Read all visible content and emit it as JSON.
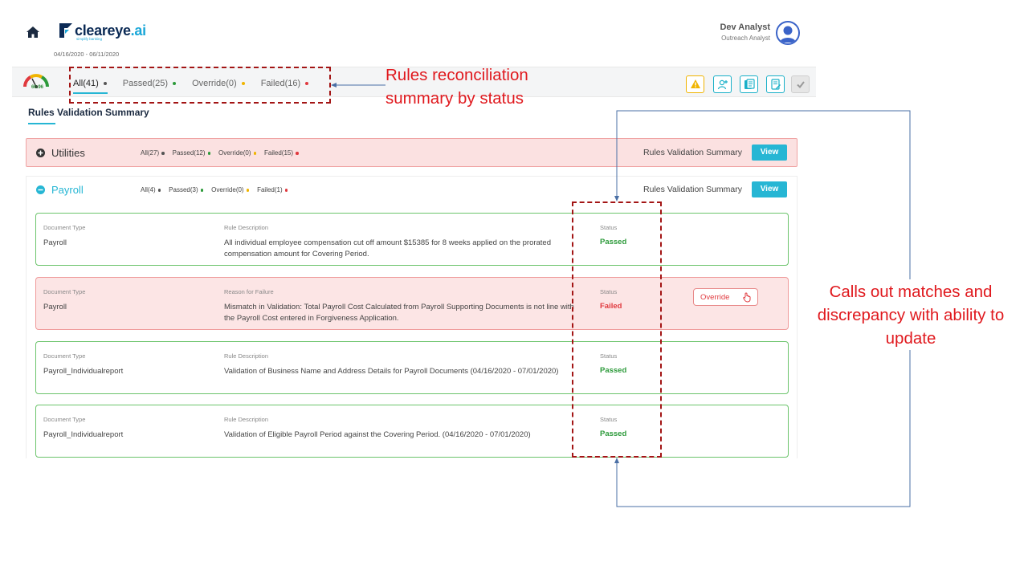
{
  "header": {
    "logo_text": "cleareye",
    "logo_suffix": ".ai",
    "logo_tagline": "simplify banking",
    "date_range": "04/16/2020 - 06/11/2020",
    "user_name": "Dev Analyst",
    "user_role": "Outreach Analyst"
  },
  "gauge": {
    "score": "60.96",
    "score_value": 60.96
  },
  "status_tabs": [
    {
      "label": "All(41)",
      "dot_color": "#555555"
    },
    {
      "label": "Passed(25)",
      "dot_color": "#2c9a3a"
    },
    {
      "label": "Override(0)",
      "dot_color": "#f0b400"
    },
    {
      "label": "Failed(16)",
      "dot_color": "#e0393e"
    }
  ],
  "toolbar_icons": [
    "warning-icon",
    "add-user-icon",
    "document-icon",
    "report-edit-icon",
    "check-icon"
  ],
  "section_title": "Rules Validation Summary",
  "groups": [
    {
      "name": "Utilities",
      "counts": [
        "All(27)",
        "Passed(12)",
        "Override(0)",
        "Failed(15)"
      ],
      "summary_label": "Rules Validation Summary",
      "view_label": "View"
    },
    {
      "name": "Payroll",
      "counts": [
        "All(4)",
        "Passed(3)",
        "Override(0)",
        "Failed(1)"
      ],
      "summary_label": "Rules Validation Summary",
      "view_label": "View"
    }
  ],
  "rules": [
    {
      "doc_type_label": "Document Type",
      "doc_type": "Payroll",
      "desc_label": "Rule Description",
      "description": "All individual employee compensation cut off amount $15385 for 8 weeks applied on the prorated compensation amount for Covering Period.",
      "status_label": "Status",
      "status": "Passed"
    },
    {
      "doc_type_label": "Document Type",
      "doc_type": "Payroll",
      "desc_label": "Reason for Failure",
      "description": "Mismatch in Validation: Total Payroll Cost Calculated from Payroll Supporting Documents is not line with the Payroll Cost entered in Forgiveness Application.",
      "status_label": "Status",
      "status": "Failed",
      "action_label": "Override"
    },
    {
      "doc_type_label": "Document Type",
      "doc_type": "Payroll_Individualreport",
      "desc_label": "Rule Description",
      "description": "Validation of Business Name and Address Details for Payroll Documents (04/16/2020 - 07/01/2020)",
      "status_label": "Status",
      "status": "Passed"
    },
    {
      "doc_type_label": "Document Type",
      "doc_type": "Payroll_Individualreport",
      "desc_label": "Rule Description",
      "description": "Validation of Eligible Payroll Period against the Covering Period. (04/16/2020 - 07/01/2020)",
      "status_label": "Status",
      "status": "Passed"
    }
  ],
  "annotations": {
    "status_summary": "Rules reconciliation summary by status",
    "callout": "Calls out matches and discrepancy with ability to update",
    "color": "#e0191e"
  },
  "colors": {
    "accent": "#26b6d4",
    "passed": "#2c9a3a",
    "failed": "#e0393e",
    "override": "#f0b400"
  }
}
